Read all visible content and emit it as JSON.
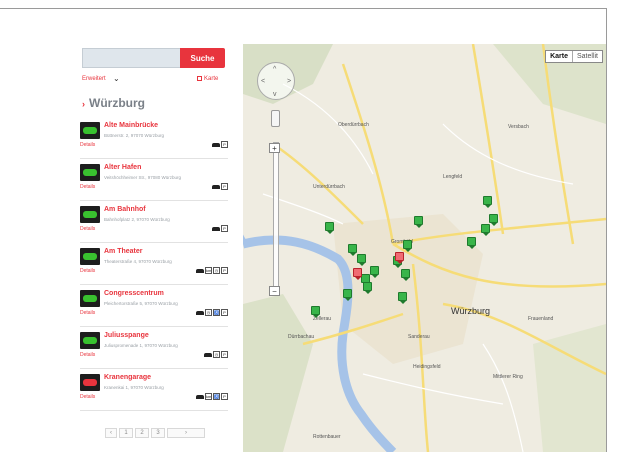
{
  "search": {
    "placeholder": "",
    "button_label": "Suche"
  },
  "filter": {
    "label": "Erweitert",
    "map_link": "Karte"
  },
  "city": "Würzburg",
  "items": [
    {
      "name": "Alte Mainbrücke",
      "address": "Büttnerstr. 2, 97070 Würzburg",
      "details": "Details",
      "status": "green",
      "icons": [
        "car",
        "sign"
      ]
    },
    {
      "name": "Alter Hafen",
      "address": "Veitshöchheimer Str., 97080 Würzburg",
      "details": "Details",
      "status": "green",
      "icons": [
        "car",
        "sign"
      ]
    },
    {
      "name": "Am Bahnhof",
      "address": "Bahnhofplatz 2, 97070 Würzburg",
      "details": "Details",
      "status": "green",
      "icons": [
        "car",
        "sign"
      ]
    },
    {
      "name": "Am Theater",
      "address": "Theaterstraße 4, 97070 Würzburg",
      "details": "Details",
      "status": "green",
      "icons": [
        "car",
        "km",
        "clock",
        "sign"
      ]
    },
    {
      "name": "Congresscentrum",
      "address": "Pleichertorstraße 5, 97070 Würzburg",
      "details": "Details",
      "status": "green",
      "icons": [
        "car",
        "clock",
        "person",
        "sign"
      ]
    },
    {
      "name": "Juliusspange",
      "address": "Juliuspromenade 1, 97070 Würzburg",
      "details": "Details",
      "status": "green",
      "icons": [
        "car",
        "clock",
        "sign"
      ]
    },
    {
      "name": "Kranengarage",
      "address": "Kranenkai 1, 97070 Würzburg",
      "details": "Details",
      "status": "red",
      "icons": [
        "car",
        "km",
        "person",
        "sign"
      ]
    }
  ],
  "pager": [
    "‹",
    "1",
    "2",
    "3",
    "›"
  ],
  "map": {
    "type_buttons": [
      "Karte",
      "Satellit"
    ],
    "zoom_in": "+",
    "zoom_out": "−",
    "city_label": "Würzburg",
    "labels": [
      "Oberdürrbach",
      "Versbach",
      "Unterdürrbach",
      "Lengfeld",
      "Grombühl",
      "Zellerau",
      "Frauenland",
      "Sanderau",
      "Heidingsfeld",
      "Dürrbachau",
      "Mittlerer Ring",
      "Rottenbauer"
    ]
  },
  "colors": {
    "accent": "#e8343d",
    "available": "#39c12f",
    "full": "#e8343d",
    "map_bg": "#efece1",
    "river": "#a6c3e8",
    "road": "#f6dc77"
  }
}
